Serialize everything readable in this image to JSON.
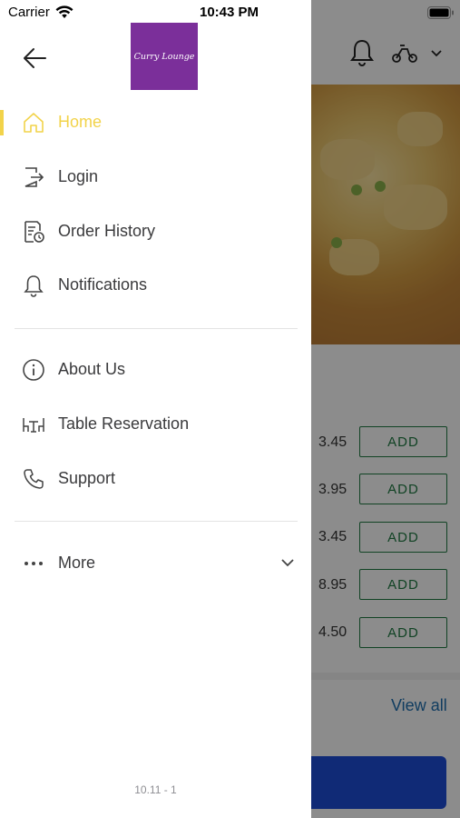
{
  "status_bar": {
    "carrier": "Carrier",
    "time": "10:43 PM"
  },
  "drawer": {
    "logo_text": "Curry Lounge",
    "menu": [
      {
        "label": "Home",
        "icon": "home-icon",
        "active": true
      },
      {
        "label": "Login",
        "icon": "login-icon"
      },
      {
        "label": "Order History",
        "icon": "order-history-icon"
      },
      {
        "label": "Notifications",
        "icon": "bell-icon"
      },
      {
        "label": "About Us",
        "icon": "info-icon"
      },
      {
        "label": "Table Reservation",
        "icon": "table-icon"
      },
      {
        "label": "Support",
        "icon": "phone-icon"
      },
      {
        "label": "More",
        "icon": "more-dots-icon"
      }
    ],
    "version": "10.11 - 1",
    "accent_color": "#f2d34a"
  },
  "background_app": {
    "items": [
      {
        "price": "3.45",
        "action": "ADD"
      },
      {
        "price": "3.95",
        "action": "ADD"
      },
      {
        "price": "3.45",
        "action": "ADD"
      },
      {
        "price": "8.95",
        "action": "ADD"
      },
      {
        "price": "4.50",
        "action": "ADD"
      }
    ],
    "view_all": "View all",
    "logo_color": "#7b2f9a",
    "add_color": "#1f7a43"
  }
}
